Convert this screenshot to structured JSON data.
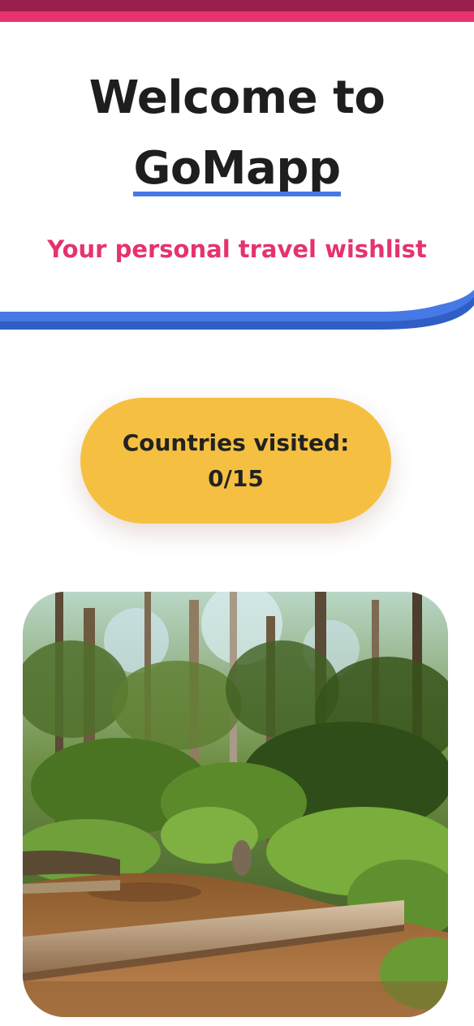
{
  "header": {
    "title_line1": "Welcome to",
    "title_line2": "GoMapp",
    "subtitle": "Your personal travel wishlist"
  },
  "counter": {
    "label": "Countries visited:",
    "value": "0/15",
    "visited": 0,
    "total": 15
  },
  "photo": {
    "icon": "forest-creek-photo"
  },
  "colors": {
    "top_stripe_dark": "#9b1f4d",
    "top_stripe_pink": "#e8336e",
    "accent_blue": "#4679e6",
    "subtitle_pink": "#e5336d",
    "counter_yellow": "#f5c041",
    "text_dark": "#1e1e1e"
  }
}
